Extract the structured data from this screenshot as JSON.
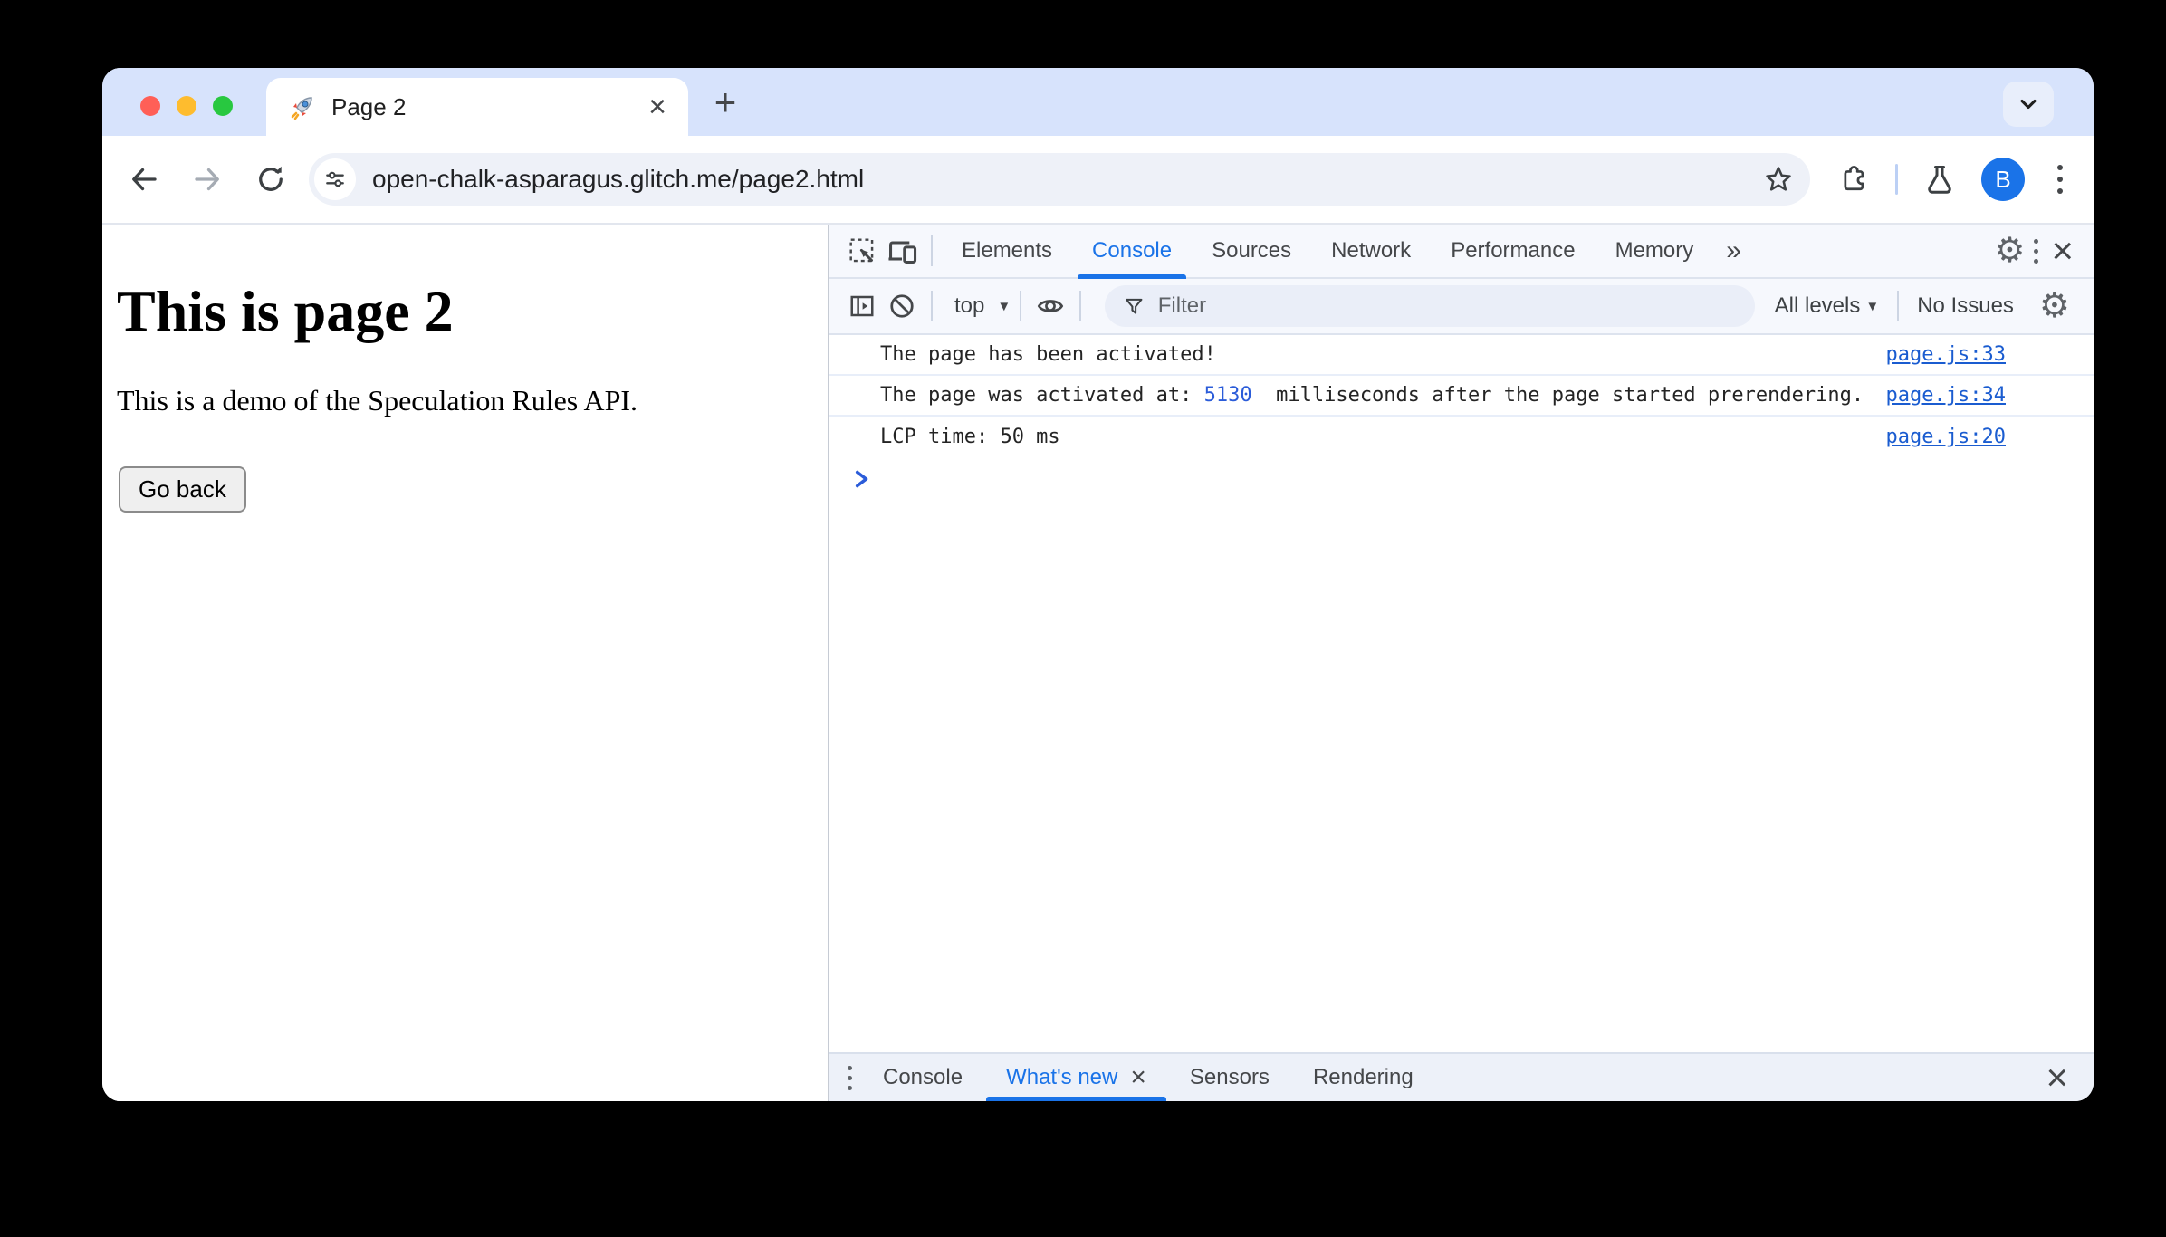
{
  "browser": {
    "tab_title": "Page 2",
    "url": "open-chalk-asparagus.glitch.me/page2.html",
    "avatar_letter": "B",
    "new_tab_glyph": "+",
    "tab_close_glyph": "×"
  },
  "page": {
    "heading": "This is page 2",
    "paragraph": "This is a demo of the Speculation Rules API.",
    "back_button_label": "Go back"
  },
  "devtools": {
    "tabs": [
      "Elements",
      "Console",
      "Sources",
      "Network",
      "Performance",
      "Memory"
    ],
    "active_tab": "Console",
    "more_tabs_glyph": "»",
    "gear_glyph": "⚙",
    "close_glyph": "×",
    "toolbar": {
      "context_selector": "top",
      "caret_glyph": "▼",
      "filter_placeholder": "Filter",
      "levels_label": "All levels",
      "issues_label": "No Issues"
    },
    "console_messages": [
      {
        "text_before": "The page has been activated!",
        "number": "",
        "text_after": "",
        "source": "page.js:33"
      },
      {
        "text_before": "The page was activated at: ",
        "number": "5130",
        "text_after": "  milliseconds after the page started prerendering.",
        "source": "page.js:34"
      },
      {
        "text_before": "LCP time: 50 ms",
        "number": "",
        "text_after": "",
        "source": "page.js:20"
      }
    ],
    "drawer": {
      "tabs": [
        "Console",
        "What's new",
        "Sensors",
        "Rendering"
      ],
      "active_tab": "What's new",
      "active_close_glyph": "×",
      "close_glyph": "×"
    }
  },
  "colors": {
    "accent_blue": "#1a73e8",
    "tab_strip": "#d7e3fc",
    "link_blue": "#1a5cd0",
    "number_blue": "#2b5cd9",
    "traffic_red": "#ff5f57",
    "traffic_yellow": "#febc2e",
    "traffic_green": "#28c840"
  }
}
